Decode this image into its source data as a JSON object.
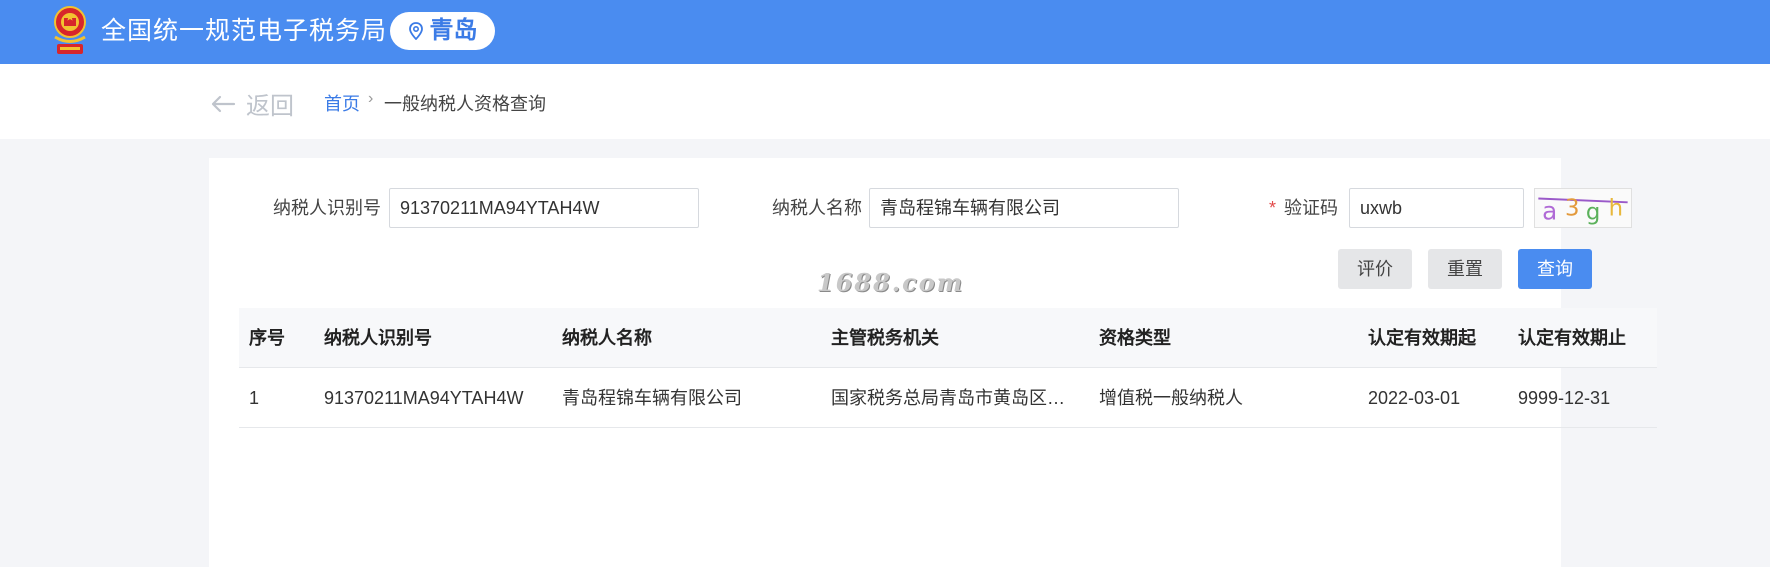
{
  "header": {
    "title": "全国统一规范电子税务局",
    "city": "青岛",
    "brand_color": "#4a8cf0"
  },
  "breadcrumb": {
    "back_label": "返回",
    "home_label": "首页",
    "separator": "›",
    "current_label": "一般纳税人资格查询"
  },
  "form": {
    "taxpayer_id_label": "纳税人识别号",
    "taxpayer_id_value": "91370211MA94YTAH4W",
    "taxpayer_name_label": "纳税人名称",
    "taxpayer_name_value": "青岛程锦车辆有限公司",
    "captcha_required_mark": "*",
    "captcha_label": "验证码",
    "captcha_value": "uxwb",
    "captcha_image_text": "a3gh"
  },
  "buttons": {
    "evaluate_label": "评价",
    "reset_label": "重置",
    "query_label": "查询"
  },
  "watermark": "1688.com",
  "table": {
    "columns": [
      "序号",
      "纳税人识别号",
      "纳税人名称",
      "主管税务机关",
      "资格类型",
      "认定有效期起",
      "认定有效期止"
    ],
    "rows": [
      [
        "1",
        "91370211MA94YTAH4W",
        "青岛程锦车辆有限公司",
        "国家税务总局青岛市黄岛区税…",
        "增值税一般纳税人",
        "2022-03-01",
        "9999-12-31"
      ]
    ]
  }
}
